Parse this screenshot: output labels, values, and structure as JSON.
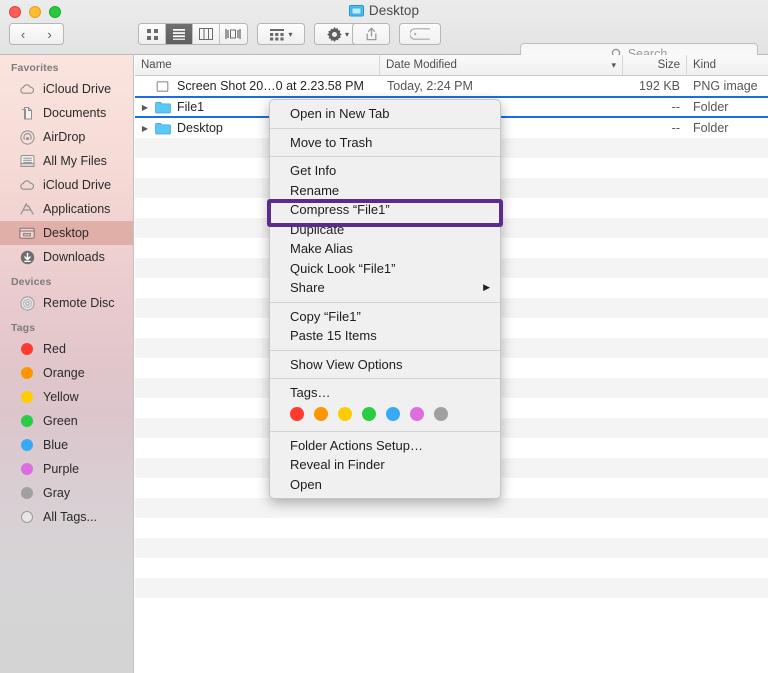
{
  "window": {
    "title": "Desktop",
    "title_icon": "folder-icon",
    "traffic_lights": [
      "close-button",
      "minimize-button",
      "maximize-button"
    ],
    "colors": {
      "close": "#ff5f57",
      "minimize": "#febc2e",
      "maximize": "#28c840",
      "selection_blue": "#1a6ee0",
      "highlight_purple": "#5b2c8d"
    }
  },
  "toolbar": {
    "back_glyph": "‹",
    "forward_glyph": "›",
    "view_modes": [
      {
        "name": "icon-view",
        "active": false
      },
      {
        "name": "list-view",
        "active": true
      },
      {
        "name": "column-view",
        "active": false
      },
      {
        "name": "coverflow-view",
        "active": false
      }
    ],
    "arrange_label": "arrange-button",
    "action_label": "action-gear-button",
    "share_label": "share-button",
    "tag_label": "tag-button",
    "caret": "▾"
  },
  "search": {
    "placeholder": "Search",
    "label": "Search",
    "icon": "search-icon"
  },
  "sidebar": {
    "sections": [
      {
        "header": "Favorites",
        "items": [
          {
            "label": "iCloud Drive",
            "icon": "cloud-icon",
            "selected": false
          },
          {
            "label": "Documents",
            "icon": "documents-icon",
            "selected": false
          },
          {
            "label": "AirDrop",
            "icon": "airdrop-icon",
            "selected": false
          },
          {
            "label": "All My Files",
            "icon": "all-my-files-icon",
            "selected": false
          },
          {
            "label": "iCloud Drive",
            "icon": "cloud-icon",
            "selected": false
          },
          {
            "label": "Applications",
            "icon": "applications-icon",
            "selected": false
          },
          {
            "label": "Desktop",
            "icon": "desktop-icon",
            "selected": true
          },
          {
            "label": "Downloads",
            "icon": "downloads-icon",
            "selected": false
          }
        ]
      },
      {
        "header": "Devices",
        "items": [
          {
            "label": "Remote Disc",
            "icon": "optical-disc-icon",
            "selected": false
          }
        ]
      },
      {
        "header": "Tags",
        "items": [
          {
            "label": "Red",
            "icon": "tag-dot-icon",
            "color": "#ff3b30",
            "selected": false
          },
          {
            "label": "Orange",
            "icon": "tag-dot-icon",
            "color": "#ff9500",
            "selected": false
          },
          {
            "label": "Yellow",
            "icon": "tag-dot-icon",
            "color": "#ffcc00",
            "selected": false
          },
          {
            "label": "Green",
            "icon": "tag-dot-icon",
            "color": "#28cd41",
            "selected": false
          },
          {
            "label": "Blue",
            "icon": "tag-dot-icon",
            "color": "#3aa9f5",
            "selected": false
          },
          {
            "label": "Purple",
            "icon": "tag-dot-icon",
            "color": "#dd6ee0",
            "selected": false
          },
          {
            "label": "Gray",
            "icon": "tag-dot-icon",
            "color": "#a0a0a0",
            "selected": false
          },
          {
            "label": "All Tags...",
            "icon": "tag-ring-icon",
            "color": "",
            "selected": false
          }
        ]
      }
    ]
  },
  "filelist": {
    "columns": [
      {
        "key": "name",
        "label": "Name"
      },
      {
        "key": "date",
        "label": "Date Modified",
        "sort_indicator": "▾"
      },
      {
        "key": "size",
        "label": "Size"
      },
      {
        "key": "kind",
        "label": "Kind"
      }
    ],
    "rows": [
      {
        "name": "Screen Shot 20…0 at 2.23.58 PM",
        "date": "Today, 2:24 PM",
        "size": "192 KB",
        "kind": "PNG image",
        "icon": "image-file-icon",
        "disclosure": false,
        "selected": false
      },
      {
        "name": "File1",
        "date": "",
        "size": "--",
        "kind": "Folder",
        "icon": "folder-icon",
        "disclosure": true,
        "selected": true
      },
      {
        "name": "Desktop",
        "date": "",
        "size": "--",
        "kind": "Folder",
        "icon": "folder-icon",
        "disclosure": true,
        "selected": false
      }
    ],
    "empty_row_count": 24
  },
  "context_menu": {
    "groups": [
      {
        "items": [
          {
            "label": "Open in New Tab",
            "submenu": false
          }
        ]
      },
      {
        "items": [
          {
            "label": "Move to Trash",
            "submenu": false
          }
        ]
      },
      {
        "items": [
          {
            "label": "Get Info",
            "submenu": false
          },
          {
            "label": "Rename",
            "submenu": false
          },
          {
            "label": "Compress “File1”",
            "submenu": false,
            "highlighted": true
          },
          {
            "label": "Duplicate",
            "submenu": false
          },
          {
            "label": "Make Alias",
            "submenu": false
          },
          {
            "label": "Quick Look “File1”",
            "submenu": false
          },
          {
            "label": "Share",
            "submenu": true,
            "arrow": "▶"
          }
        ]
      },
      {
        "items": [
          {
            "label": "Copy “File1”",
            "submenu": false
          },
          {
            "label": "Paste 15 Items",
            "submenu": false
          }
        ]
      },
      {
        "items": [
          {
            "label": "Show View Options",
            "submenu": false
          }
        ]
      },
      {
        "items": [
          {
            "label": "Tags…",
            "submenu": false
          }
        ],
        "swatches": [
          "#ff3b30",
          "#ff9500",
          "#ffcc00",
          "#28cd41",
          "#3aa9f5",
          "#dd6ee0",
          "#a0a0a0"
        ]
      },
      {
        "items": [
          {
            "label": "Folder Actions Setup…",
            "submenu": false
          },
          {
            "label": "Reveal in Finder",
            "submenu": false
          },
          {
            "label": "Open",
            "submenu": false
          }
        ]
      }
    ]
  }
}
